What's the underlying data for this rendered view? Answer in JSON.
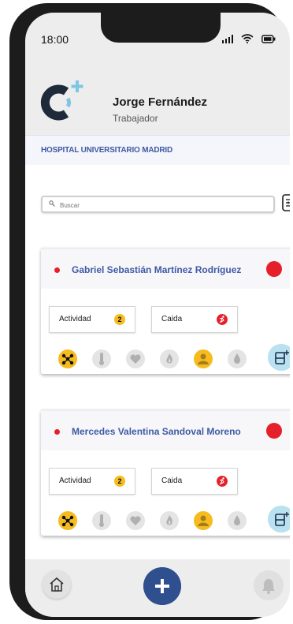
{
  "status_bar": {
    "time": "18:00"
  },
  "user": {
    "name": "Jorge Fernández",
    "role": "Trabajador"
  },
  "hospital": {
    "name": "HOSPITAL UNIVERSITARIO MADRID"
  },
  "search": {
    "placeholder": "Buscar"
  },
  "patients": [
    {
      "name": "Gabriel Sebastián Martínez Rodríguez",
      "activity_label": "Actividad",
      "activity_count": "2",
      "fall_label": "Caida",
      "sensors": [
        "network-icon",
        "thermometer-icon",
        "heart-icon",
        "flame-icon",
        "person-icon",
        "drop-icon"
      ]
    },
    {
      "name": "Mercedes Valentina Sandoval Moreno",
      "activity_label": "Actividad",
      "activity_count": "2",
      "fall_label": "Caida",
      "sensors": [
        "network-icon",
        "thermometer-icon",
        "heart-icon",
        "flame-icon",
        "person-icon",
        "drop-icon"
      ]
    }
  ],
  "colors": {
    "accent_blue": "#3f5aa3",
    "alert_red": "#e5202a",
    "badge_yellow": "#f6bc1f",
    "nav_blue": "#2f4f8f",
    "light_blue": "#b9e1ef"
  }
}
